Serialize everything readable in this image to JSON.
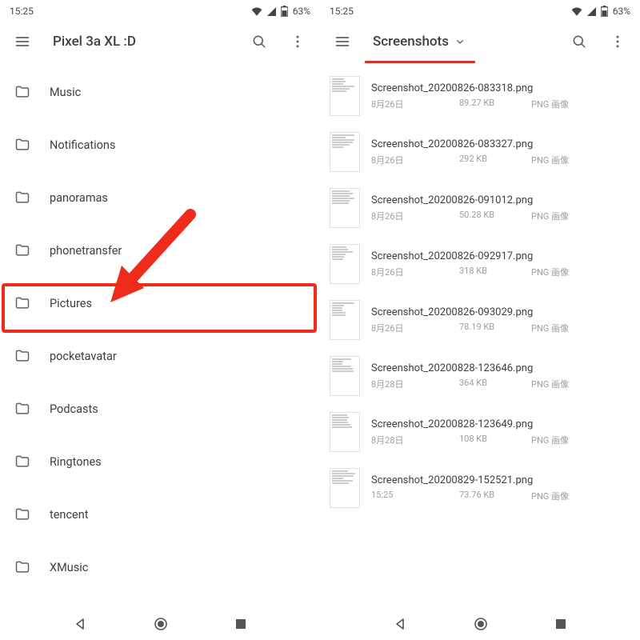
{
  "statusbar": {
    "time": "15:25",
    "battery": "63%"
  },
  "left": {
    "title": "Pixel 3a XL :D",
    "folders": [
      {
        "name": "Music"
      },
      {
        "name": "Notifications"
      },
      {
        "name": "panoramas"
      },
      {
        "name": "phonetransfer"
      },
      {
        "name": "Pictures"
      },
      {
        "name": "pocketavatar"
      },
      {
        "name": "Podcasts"
      },
      {
        "name": "Ringtones"
      },
      {
        "name": "tencent"
      },
      {
        "name": "XMusic"
      }
    ],
    "highlight_index": 4
  },
  "right": {
    "title": "Screenshots",
    "files": [
      {
        "name": "Screenshot_20200826-083318.png",
        "date": "8月26日",
        "size": "89.27 KB",
        "type": "PNG 画像"
      },
      {
        "name": "Screenshot_20200826-083327.png",
        "date": "8月26日",
        "size": "292 KB",
        "type": "PNG 画像"
      },
      {
        "name": "Screenshot_20200826-091012.png",
        "date": "8月26日",
        "size": "50.28 KB",
        "type": "PNG 画像"
      },
      {
        "name": "Screenshot_20200826-092917.png",
        "date": "8月26日",
        "size": "318 KB",
        "type": "PNG 画像"
      },
      {
        "name": "Screenshot_20200826-093029.png",
        "date": "8月26日",
        "size": "78.19 KB",
        "type": "PNG 画像"
      },
      {
        "name": "Screenshot_20200828-123646.png",
        "date": "8月28日",
        "size": "364 KB",
        "type": "PNG 画像"
      },
      {
        "name": "Screenshot_20200828-123649.png",
        "date": "8月28日",
        "size": "108 KB",
        "type": "PNG 画像"
      },
      {
        "name": "Screenshot_20200829-152521.png",
        "date": "15:25",
        "size": "73.76 KB",
        "type": "PNG 画像"
      }
    ]
  },
  "annotation_color": "#ef2b1c"
}
